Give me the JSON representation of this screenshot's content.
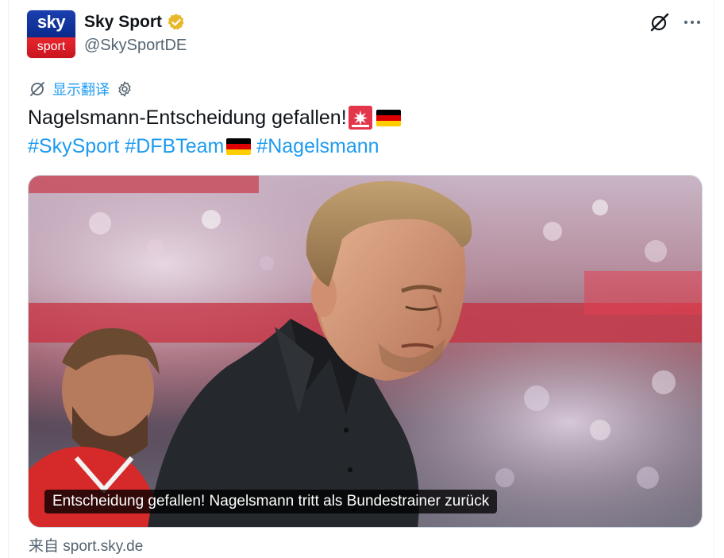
{
  "author": {
    "avatar_top": "sky",
    "avatar_bottom": "sport",
    "display_name": "Sky Sport",
    "handle": "@SkySportDE",
    "verified_color": "#e8b829"
  },
  "actions": {
    "grok_icon": "grok-icon",
    "more_icon": "more-horizontal-icon"
  },
  "translate": {
    "label": "显示翻译",
    "icon": "translate-icon",
    "settings_icon": "gear-icon"
  },
  "tweet": {
    "text": "Nagelsmann-Entscheidung gefallen!",
    "hashtags": [
      "#SkySport",
      "#DFBTeam",
      "#Nagelsmann"
    ],
    "emoji": [
      "rotating-light",
      "flag-germany"
    ]
  },
  "media": {
    "caption": "Entscheidung gefallen! Nagelsmann tritt als Bundestrainer zurück"
  },
  "source": "来自 sport.sky.de",
  "colors": {
    "link": "#1d9bf0",
    "muted": "#536471",
    "text": "#0f1419"
  }
}
